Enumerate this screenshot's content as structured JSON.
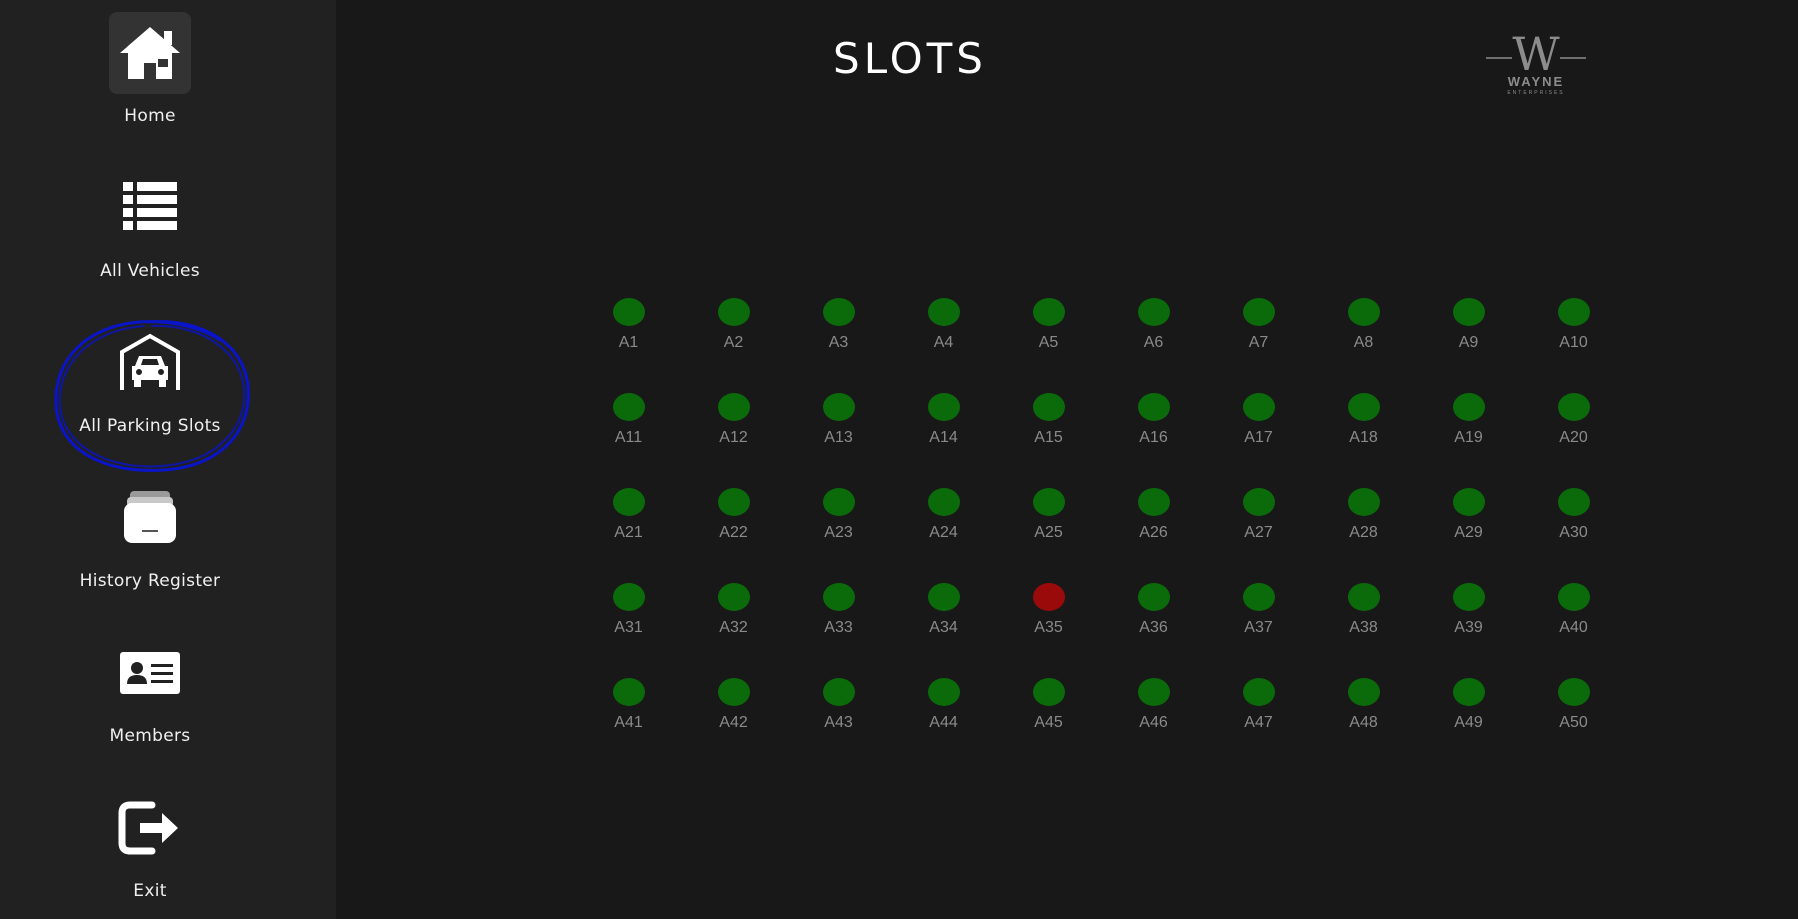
{
  "sidebar": {
    "items": [
      {
        "label": "Home",
        "icon": "home-icon"
      },
      {
        "label": "All Vehicles",
        "icon": "list-icon"
      },
      {
        "label": "All Parking Slots",
        "icon": "garage-car-icon"
      },
      {
        "label": "History Register",
        "icon": "archive-box-icon"
      },
      {
        "label": "Members",
        "icon": "id-card-icon"
      },
      {
        "label": "Exit",
        "icon": "exit-icon"
      }
    ],
    "highlighted": "All Parking Slots",
    "annotation_color": "#0a14c8"
  },
  "header": {
    "title": "SLOTS",
    "logo": {
      "mark": "W",
      "name": "WAYNE",
      "tagline": "ENTERPRISES"
    }
  },
  "colors": {
    "available": "#0b6b0b",
    "occupied": "#9b0a0a",
    "sidebar_bg": "#212121",
    "main_bg": "#181818"
  },
  "slots": [
    {
      "label": "A1",
      "status": "available"
    },
    {
      "label": "A2",
      "status": "available"
    },
    {
      "label": "A3",
      "status": "available"
    },
    {
      "label": "A4",
      "status": "available"
    },
    {
      "label": "A5",
      "status": "available"
    },
    {
      "label": "A6",
      "status": "available"
    },
    {
      "label": "A7",
      "status": "available"
    },
    {
      "label": "A8",
      "status": "available"
    },
    {
      "label": "A9",
      "status": "available"
    },
    {
      "label": "A10",
      "status": "available"
    },
    {
      "label": "A11",
      "status": "available"
    },
    {
      "label": "A12",
      "status": "available"
    },
    {
      "label": "A13",
      "status": "available"
    },
    {
      "label": "A14",
      "status": "available"
    },
    {
      "label": "A15",
      "status": "available"
    },
    {
      "label": "A16",
      "status": "available"
    },
    {
      "label": "A17",
      "status": "available"
    },
    {
      "label": "A18",
      "status": "available"
    },
    {
      "label": "A19",
      "status": "available"
    },
    {
      "label": "A20",
      "status": "available"
    },
    {
      "label": "A21",
      "status": "available"
    },
    {
      "label": "A22",
      "status": "available"
    },
    {
      "label": "A23",
      "status": "available"
    },
    {
      "label": "A24",
      "status": "available"
    },
    {
      "label": "A25",
      "status": "available"
    },
    {
      "label": "A26",
      "status": "available"
    },
    {
      "label": "A27",
      "status": "available"
    },
    {
      "label": "A28",
      "status": "available"
    },
    {
      "label": "A29",
      "status": "available"
    },
    {
      "label": "A30",
      "status": "available"
    },
    {
      "label": "A31",
      "status": "available"
    },
    {
      "label": "A32",
      "status": "available"
    },
    {
      "label": "A33",
      "status": "available"
    },
    {
      "label": "A34",
      "status": "available"
    },
    {
      "label": "A35",
      "status": "occupied"
    },
    {
      "label": "A36",
      "status": "available"
    },
    {
      "label": "A37",
      "status": "available"
    },
    {
      "label": "A38",
      "status": "available"
    },
    {
      "label": "A39",
      "status": "available"
    },
    {
      "label": "A40",
      "status": "available"
    },
    {
      "label": "A41",
      "status": "available"
    },
    {
      "label": "A42",
      "status": "available"
    },
    {
      "label": "A43",
      "status": "available"
    },
    {
      "label": "A44",
      "status": "available"
    },
    {
      "label": "A45",
      "status": "available"
    },
    {
      "label": "A46",
      "status": "available"
    },
    {
      "label": "A47",
      "status": "available"
    },
    {
      "label": "A48",
      "status": "available"
    },
    {
      "label": "A49",
      "status": "available"
    },
    {
      "label": "A50",
      "status": "available"
    }
  ]
}
